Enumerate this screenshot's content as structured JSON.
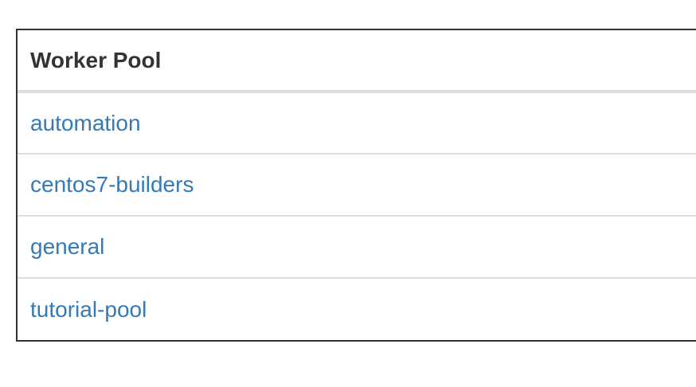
{
  "table": {
    "header": "Worker Pool",
    "rows": [
      {
        "name": "automation"
      },
      {
        "name": "centos7-builders"
      },
      {
        "name": "general"
      },
      {
        "name": "tutorial-pool"
      }
    ]
  },
  "colors": {
    "link": "#337ab7",
    "header_text": "#333333",
    "row_divider": "#dddddd",
    "border": "#333333"
  }
}
